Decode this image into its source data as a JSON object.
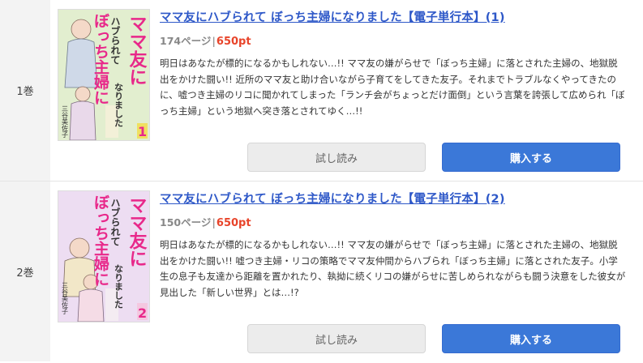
{
  "volumes": [
    {
      "label": "1巻",
      "title": "ママ友にハブられて ぼっち主婦になりました【電子単行本】(1)",
      "pages": "174ページ",
      "separator": "|",
      "price": "650pt",
      "description": "明日はあなたが標的になるかもしれない…!! ママ友の嫌がらせで「ぼっち主婦」に落とされた主婦の、地獄脱出をかけた闘い!! 近所のママ友と助け合いながら子育てをしてきた友子。それまでトラブルなくやってきたのに、嘘つき主婦のリコに聞かれてしまった「ランチ会がちょっとだけ面倒」という言葉を誇張して広められ「ぼっち主婦」という地獄へ突き落とされてゆく…!!",
      "cover": {
        "title_line1": "ママ友に",
        "title_line2": "ハブられて",
        "title_line3": "ぼっち主婦に",
        "title_line4": "なりました",
        "author": "三谷美佐子",
        "number": "1",
        "accent_color": "#e8288a",
        "bg_color": "#d8ecc4"
      },
      "sample_label": "試し読み",
      "buy_label": "購入する"
    },
    {
      "label": "2巻",
      "title": "ママ友にハブられて ぼっち主婦になりました【電子単行本】(2)",
      "pages": "150ページ",
      "separator": "|",
      "price": "650pt",
      "description": "明日はあなたが標的になるかもしれない…!! ママ友の嫌がらせで「ぼっち主婦」に落とされた主婦の、地獄脱出をかけた闘い!! 嘘つき主婦・リコの策略でママ友仲間からハブられ「ぼっち主婦」に落とされた友子。小学生の息子も友達から距離を置かれたり、執拗に続くリコの嫌がらせに苦しめられながらも闘う決意をした彼女が見出した「新しい世界」とは…!?",
      "cover": {
        "title_line1": "ママ友に",
        "title_line2": "ハブられて",
        "title_line3": "ぼっち主婦に",
        "title_line4": "なりました",
        "author": "三谷美佐子",
        "number": "2",
        "accent_color": "#e8288a",
        "bg_color": "#e6d2ee"
      },
      "sample_label": "試し読み",
      "buy_label": "購入する"
    }
  ]
}
